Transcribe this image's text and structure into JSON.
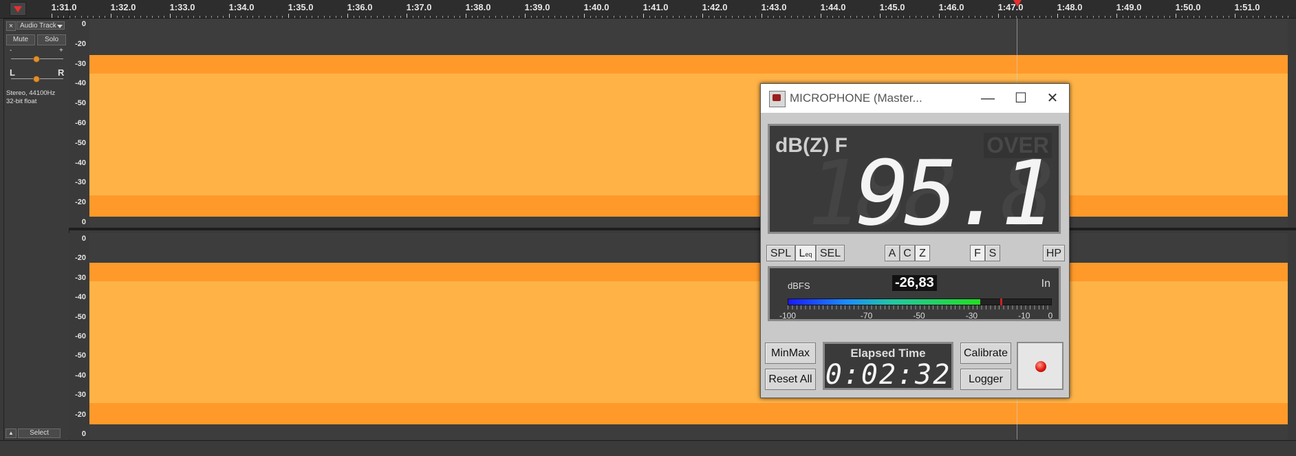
{
  "timeline": {
    "labels": [
      "1:31.0",
      "1:32.0",
      "1:33.0",
      "1:34.0",
      "1:35.0",
      "1:36.0",
      "1:37.0",
      "1:38.0",
      "1:39.0",
      "1:40.0",
      "1:41.0",
      "1:42.0",
      "1:43.0",
      "1:44.0",
      "1:45.0",
      "1:46.0",
      "1:47.0",
      "1:48.0",
      "1:49.0",
      "1:50.0",
      "1:51.0"
    ]
  },
  "track": {
    "close_symbol": "×",
    "name": "Audio Track",
    "mute_label": "Mute",
    "solo_label": "Solo",
    "gain_minus": "-",
    "gain_plus": "+",
    "pan_left": "L",
    "pan_right": "R",
    "info_line1": "Stereo, 44100Hz",
    "info_line2": "32-bit float",
    "select_label": "Select",
    "collapse_symbol": "▲"
  },
  "scale_labels": [
    "0",
    "-20",
    "-30",
    "-40",
    "-50",
    "-60",
    "-50",
    "-40",
    "-30",
    "-20",
    "0"
  ],
  "spl_meter": {
    "title": "MICROPHONE (Master...",
    "minimize_symbol": "—",
    "maximize_symbol": "☐",
    "close_symbol": "✕",
    "weighting_label": "dB(Z) F",
    "over_label": "OVER",
    "big_ghost": "188.8",
    "big_value": "95.1",
    "mode_buttons": {
      "spl": "SPL",
      "leq": "L",
      "leq_sub": "eq",
      "sel": "SEL"
    },
    "weight_buttons": {
      "a": "A",
      "c": "C",
      "z": "Z"
    },
    "time_buttons": {
      "f": "F",
      "s": "S"
    },
    "hp_label": "HP",
    "level_unit": "dBFS",
    "level_value": "-26,83",
    "level_source": "In",
    "level_fraction": 0.73,
    "peak_fraction": 0.805,
    "level_scale": [
      "-100",
      "-70",
      "-50",
      "-30",
      "-10",
      "0"
    ],
    "minmax_label": "MinMax",
    "reset_label": "Reset All",
    "elapsed_label": "Elapsed Time",
    "elapsed_value": "0:02:32",
    "calibrate_label": "Calibrate",
    "logger_label": "Logger"
  },
  "colors": {
    "wave_outer": "#ff9a2a",
    "wave_inner": "#ffb347",
    "record_led": "#e01a10"
  }
}
